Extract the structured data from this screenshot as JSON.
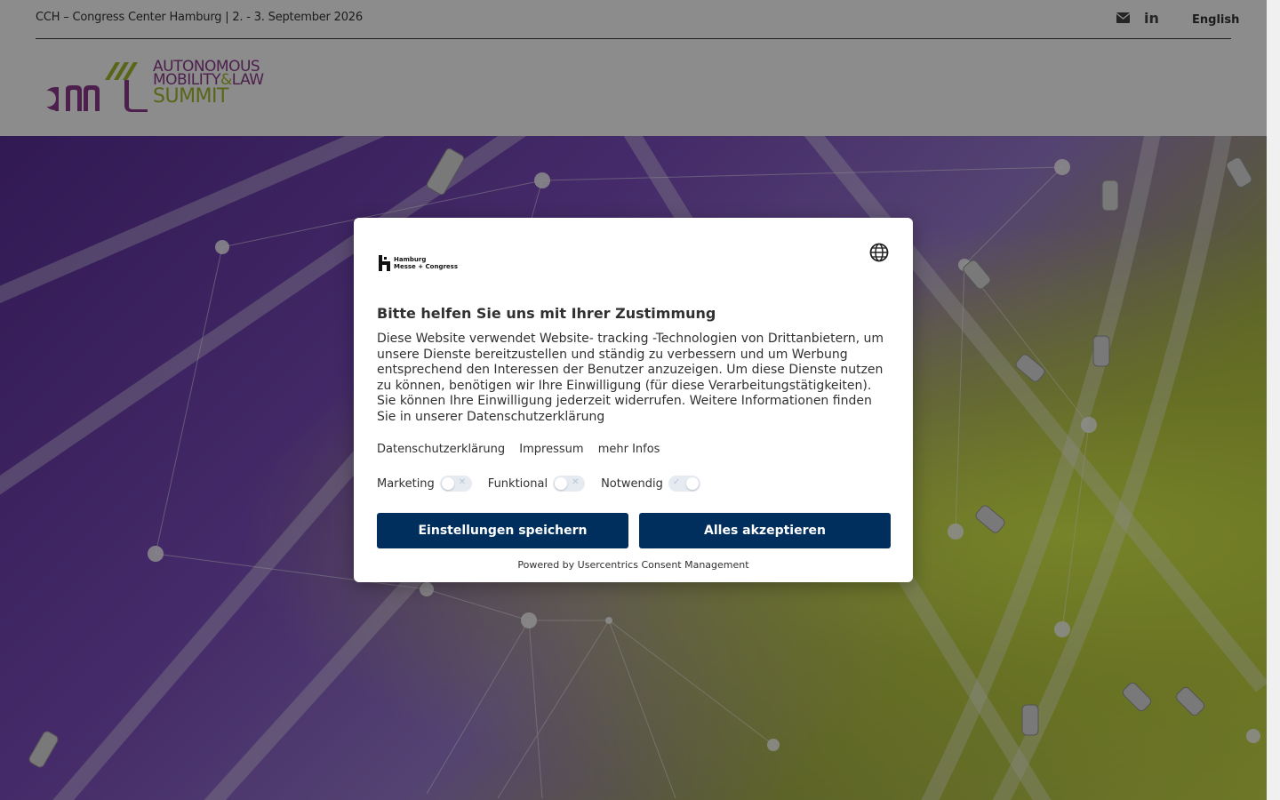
{
  "topbar": {
    "venue": "CCH – Congress Center Hamburg | 2. - 3. September 2026",
    "mail_icon": "envelope-icon",
    "linkedin_icon": "linkedin-icon",
    "linkedin_label": "in",
    "language": "English"
  },
  "logo": {
    "wordmark": "amL",
    "line1": "AUTONOMOUS",
    "line2": "MOBILITY",
    "amp": "&",
    "line2b": "LAW",
    "line3": "SUMMIT"
  },
  "consent": {
    "brand_line1": "Hamburg",
    "brand_line2": "Messe + Congress",
    "language_icon": "globe-icon",
    "title": "Bitte helfen Sie uns mit Ihrer Zustimmung",
    "description": "Diese Website verwendet Website- tracking -Technologien von Drittanbietern, um unsere Dienste bereitzustellen und ständig zu verbessern und um Werbung entsprechend den Interessen der Benutzer anzuzeigen. Um diese Dienste nutzen zu können, benötigen wir Ihre Einwilligung (für diese Verarbeitungstätigkeiten). Sie können Ihre Einwilligung jederzeit widerrufen. Weitere Informationen finden Sie in unserer Datenschutzerklärung",
    "links": [
      "Datenschutzerklärung",
      "Impressum",
      "mehr Infos"
    ],
    "toggles": [
      {
        "label": "Marketing",
        "on": false
      },
      {
        "label": "Funktional",
        "on": false
      },
      {
        "label": "Notwendig",
        "on": true
      }
    ],
    "save_button": "Einstellungen speichern",
    "accept_button": "Alles akzeptieren",
    "powered_by": "Powered by Usercentrics Consent Management"
  },
  "colors": {
    "primary_button": "#002f5d",
    "logo_purple": "#8c3a8c",
    "logo_green": "#a3b82a"
  }
}
